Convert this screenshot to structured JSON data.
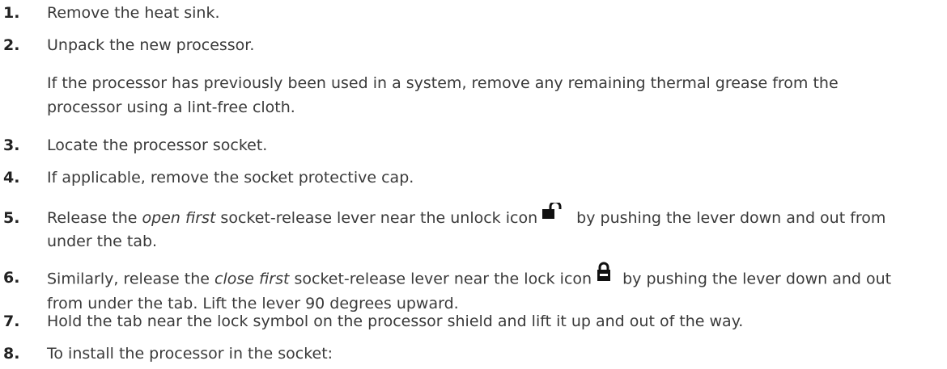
{
  "steps": [
    {
      "num": "1.",
      "text": "Remove the heat sink."
    },
    {
      "num": "2.",
      "text": "Unpack the new processor.",
      "note": "If the processor has previously been used in a system, remove any remaining thermal grease from the processor using a lint-free cloth."
    },
    {
      "num": "3.",
      "text": "Locate the processor socket."
    },
    {
      "num": "4.",
      "text": "If applicable, remove the socket protective cap."
    },
    {
      "num": "5.",
      "pre": "Release the ",
      "em": "open first",
      "mid": " socket-release lever near the unlock icon",
      "post": " by pushing the lever down and out from under the tab.",
      "icon": "unlock-icon"
    },
    {
      "num": "6.",
      "pre": "Similarly, release the ",
      "em": "close first",
      "mid": " socket-release lever near the lock icon",
      "post": " by pushing the lever down and out from under the tab. Lift the lever 90 degrees upward.",
      "icon": "lock-icon"
    },
    {
      "num": "7.",
      "text": "Hold the tab near the lock symbol on the processor shield and lift it up and out of the way."
    },
    {
      "num": "8.",
      "text": "To install the processor in the socket:"
    }
  ]
}
